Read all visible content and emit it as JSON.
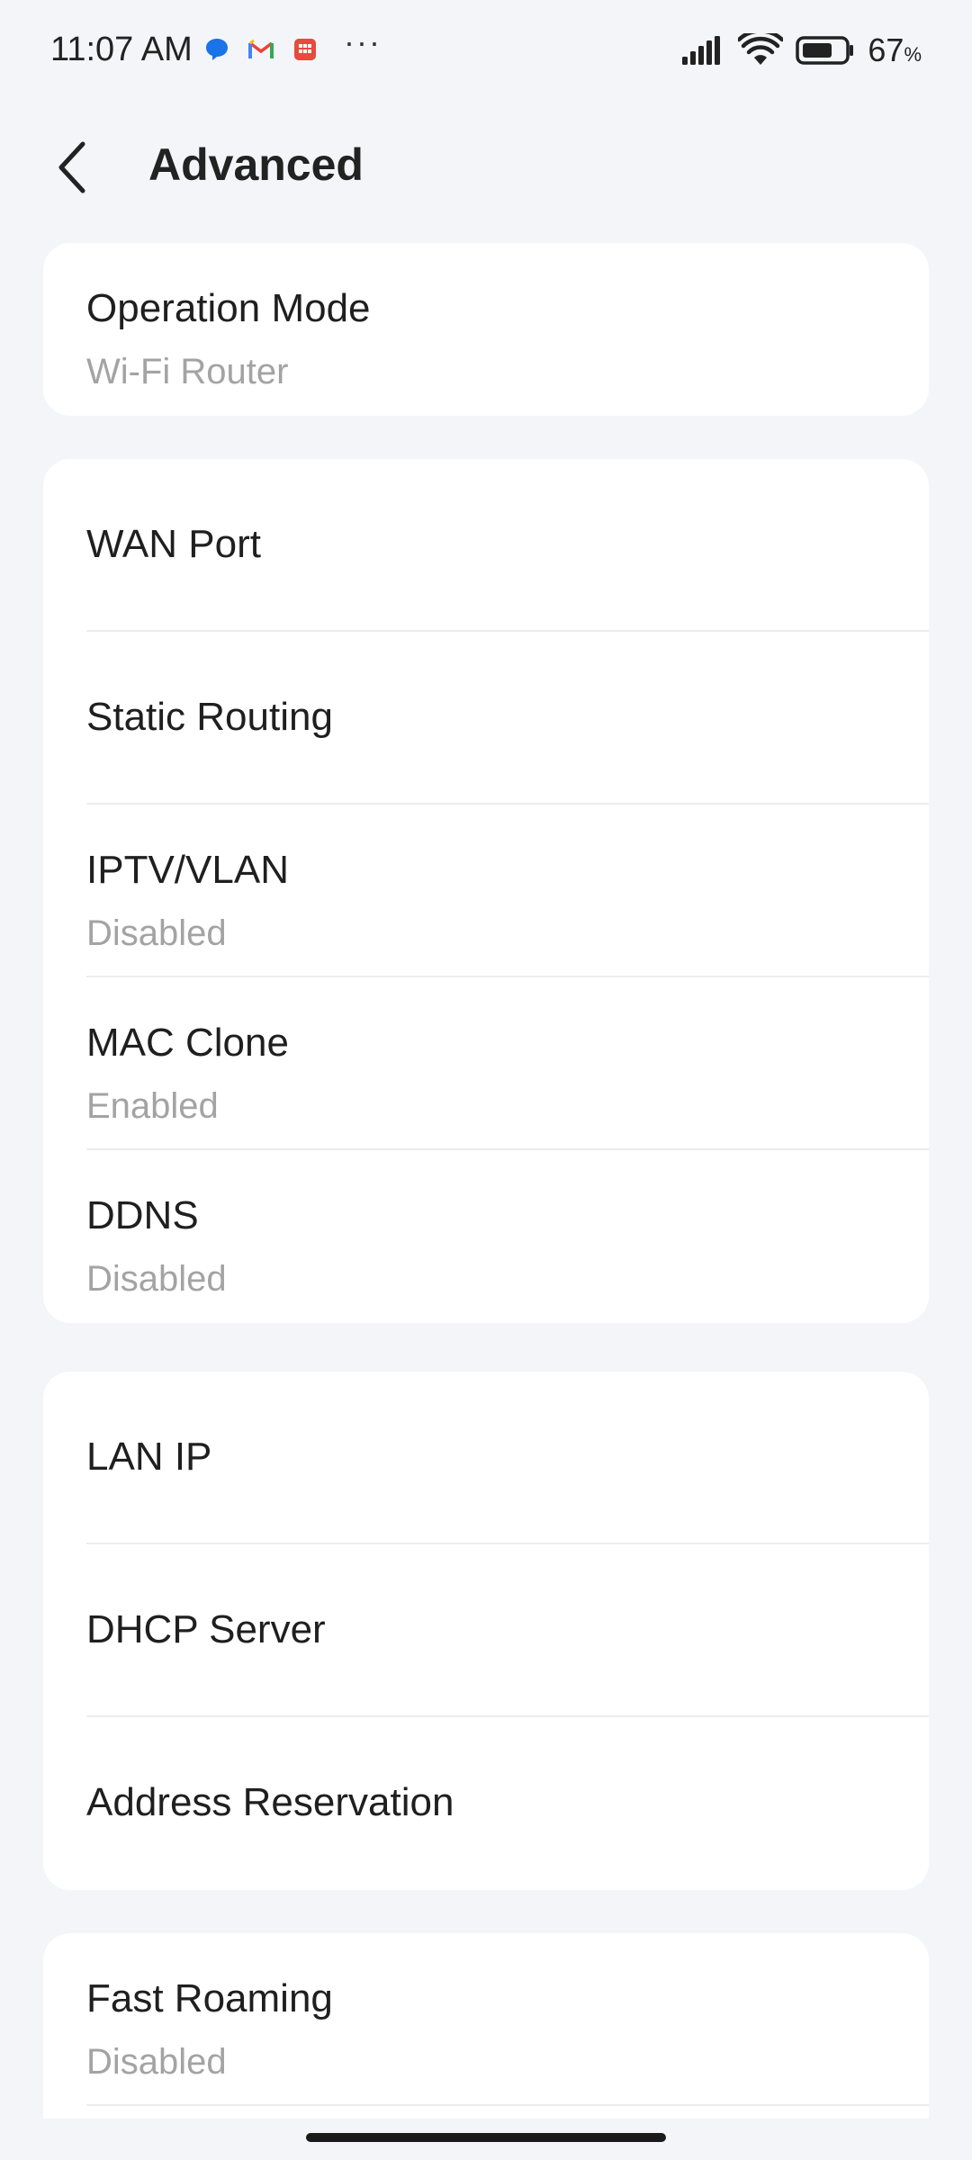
{
  "status_bar": {
    "time": "11:07 AM",
    "more": "···",
    "battery_percent": "67",
    "battery_unit": "%",
    "notification_icons": [
      "messages-icon",
      "gmail-icon",
      "calendar-icon"
    ]
  },
  "header": {
    "title": "Advanced"
  },
  "sections": [
    {
      "rows": [
        {
          "title": "Operation Mode",
          "subtitle": "Wi-Fi Router"
        }
      ]
    },
    {
      "rows": [
        {
          "title": "WAN Port"
        },
        {
          "title": "Static Routing"
        },
        {
          "title": "IPTV/VLAN",
          "subtitle": "Disabled"
        },
        {
          "title": "MAC Clone",
          "subtitle": "Enabled"
        },
        {
          "title": "DDNS",
          "subtitle": "Disabled"
        }
      ]
    },
    {
      "rows": [
        {
          "title": "LAN IP"
        },
        {
          "title": "DHCP Server"
        },
        {
          "title": "Address Reservation"
        }
      ]
    },
    {
      "rows": [
        {
          "title": "Fast Roaming",
          "subtitle": "Disabled"
        }
      ]
    }
  ],
  "colors": {
    "background": "#f4f5f9",
    "card": "#ffffff",
    "subtitle": "#a3a3a3",
    "divider": "#ececf0"
  }
}
